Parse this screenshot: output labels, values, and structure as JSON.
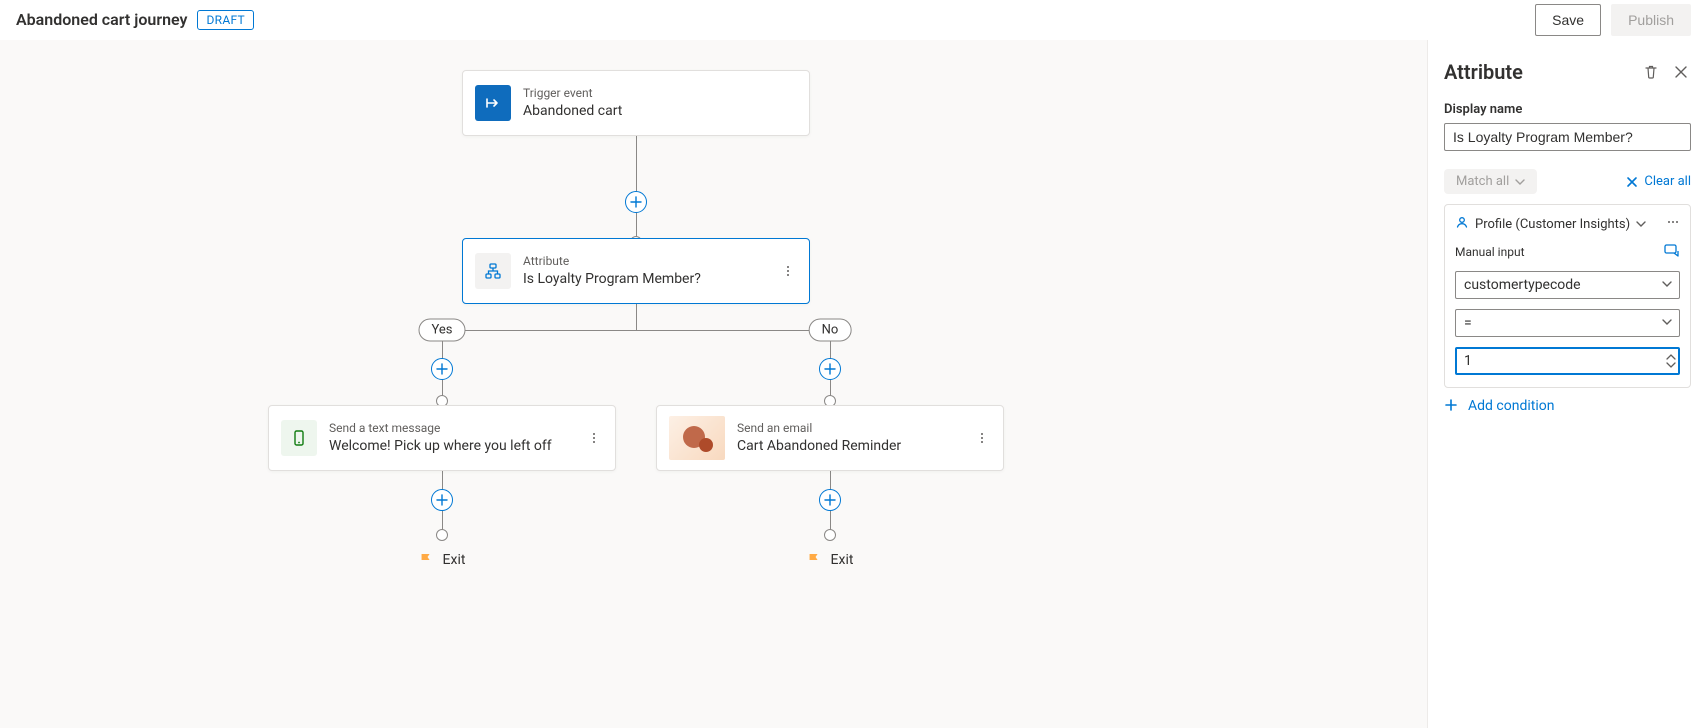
{
  "topbar": {
    "title": "Abandoned cart journey",
    "badge": "DRAFT",
    "save_label": "Save",
    "publish_label": "Publish"
  },
  "canvas": {
    "trigger": {
      "label": "Trigger event",
      "title": "Abandoned cart"
    },
    "attribute": {
      "label": "Attribute",
      "title": "Is Loyalty Program Member?"
    },
    "branch_yes": "Yes",
    "branch_no": "No",
    "sms": {
      "label": "Send a text message",
      "title": "Welcome! Pick up where you left off"
    },
    "email": {
      "label": "Send an email",
      "title": "Cart Abandoned Reminder"
    },
    "exit_label": "Exit"
  },
  "panel": {
    "title": "Attribute",
    "display_name_label": "Display name",
    "display_name_value": "Is Loyalty Program Member?",
    "match_all_label": "Match all",
    "clear_all_label": "Clear all",
    "profile_source": "Profile (Customer Insights)",
    "manual_input_label": "Manual input",
    "field_value": "customertypecode",
    "operator_value": "=",
    "number_value": "1",
    "add_condition_label": "Add condition"
  }
}
